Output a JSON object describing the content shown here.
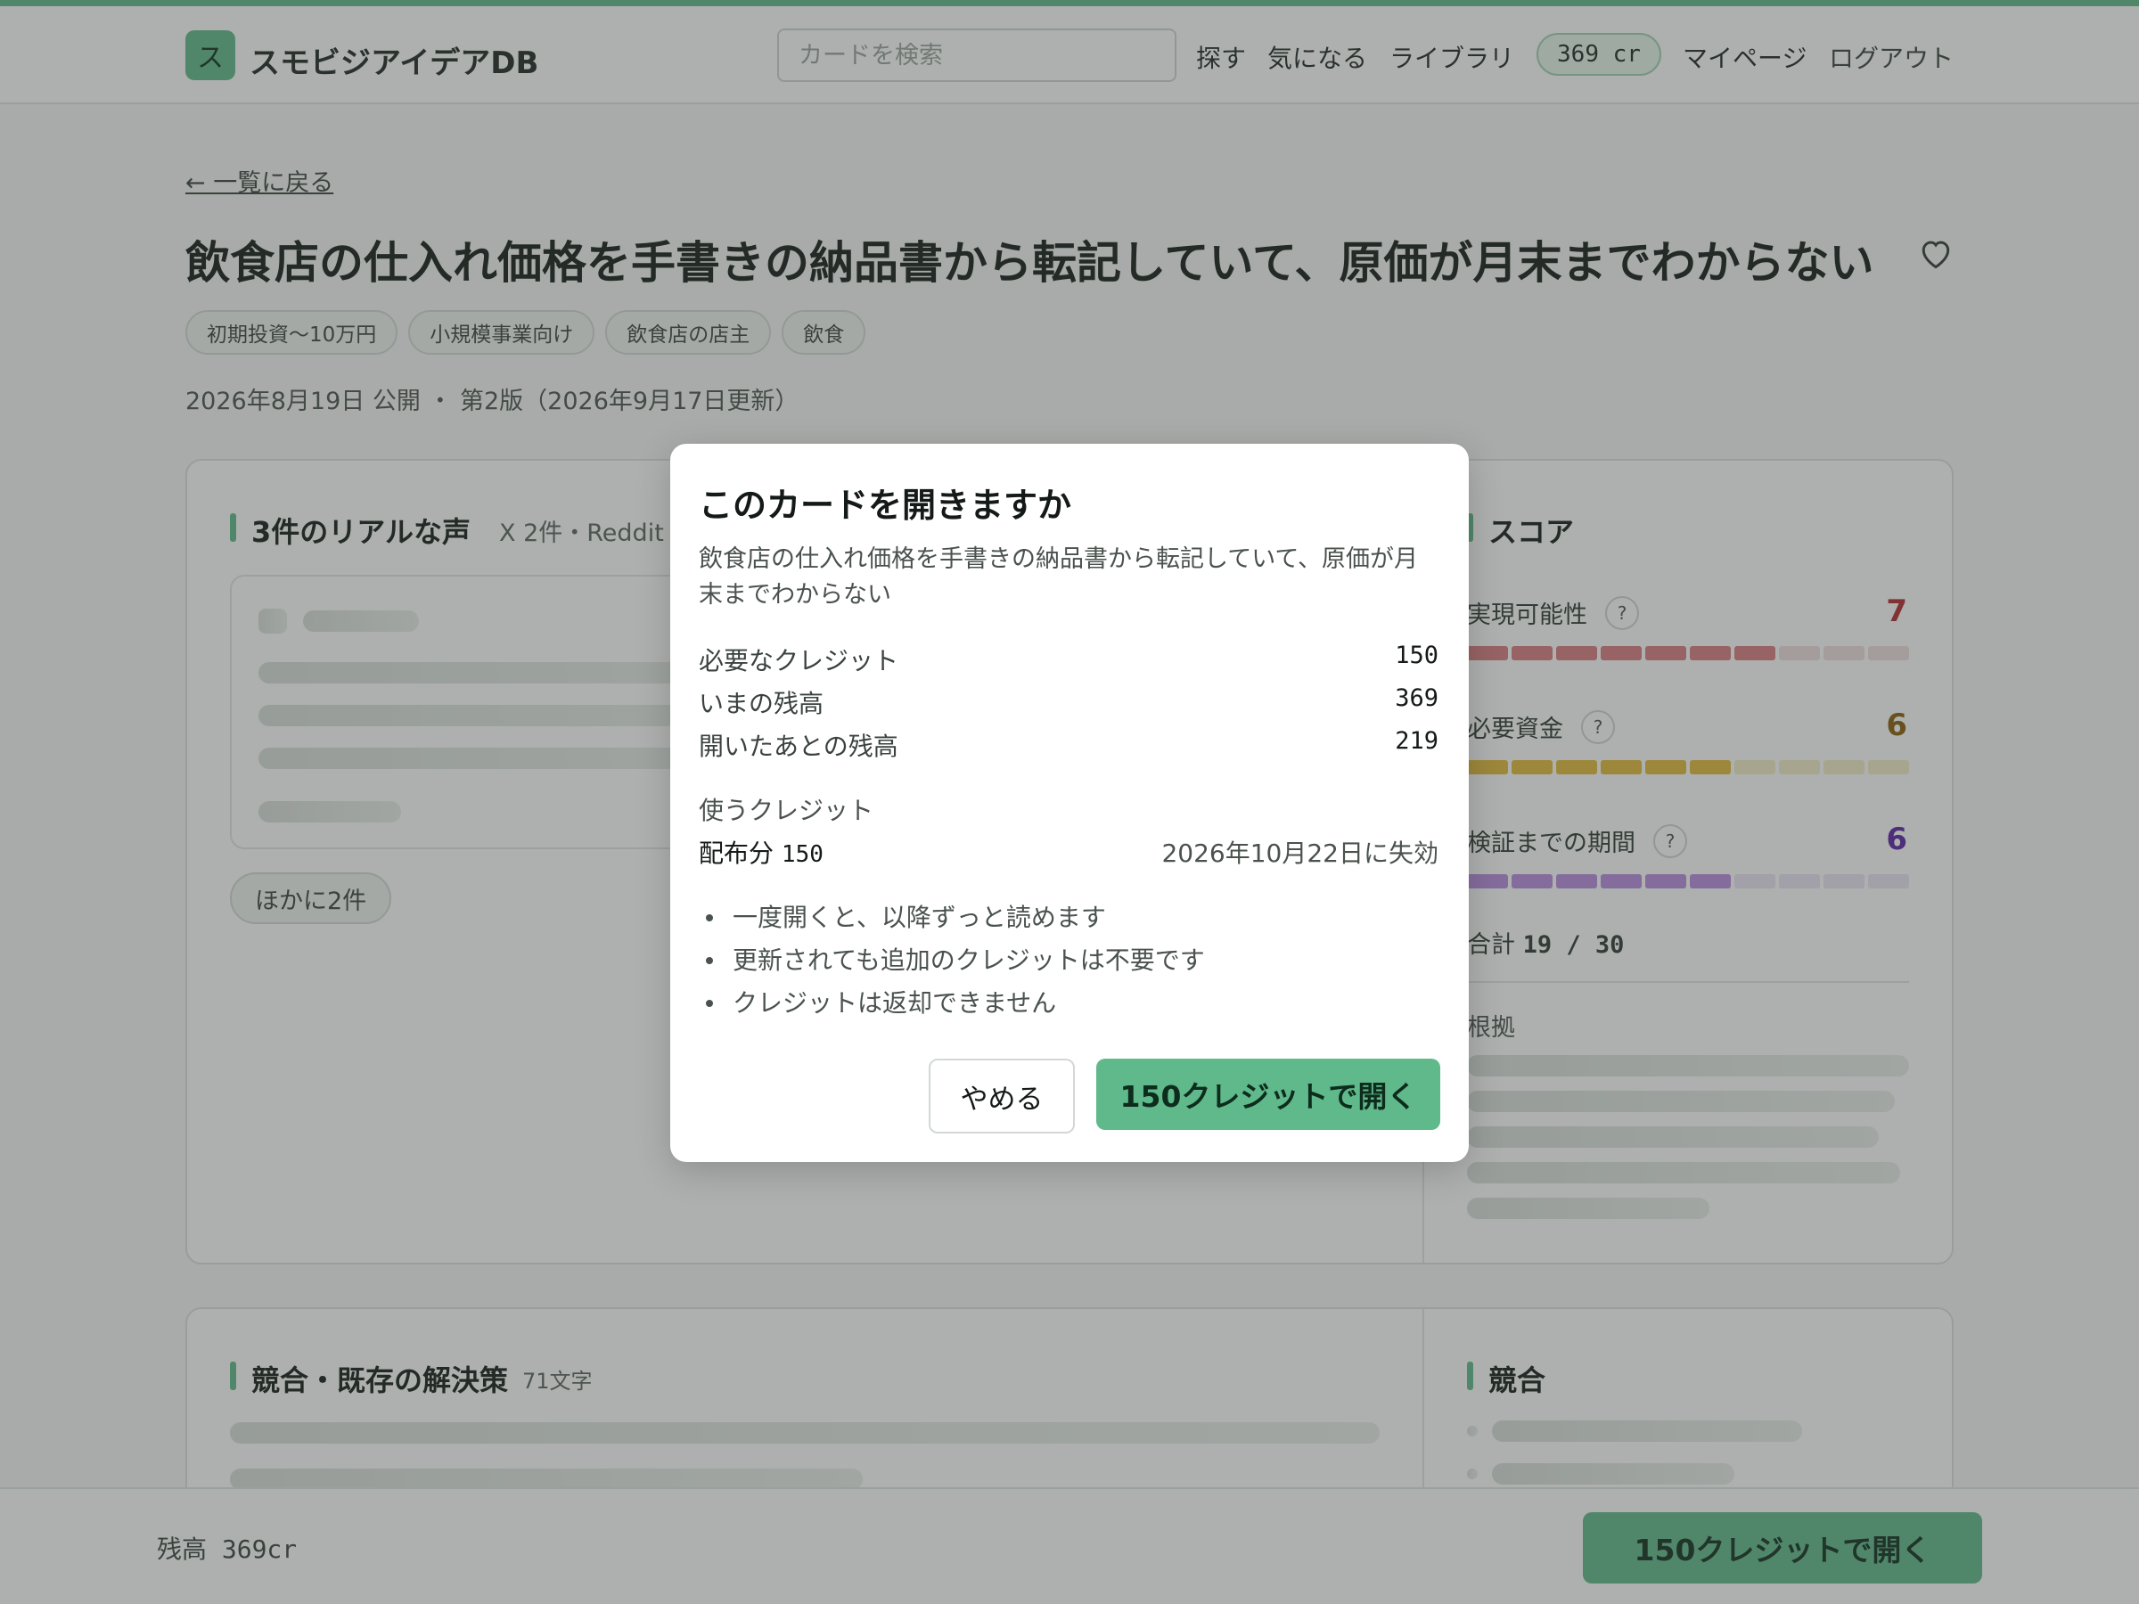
{
  "header": {
    "logo_char": "ス",
    "site_name": "スモビジアイデアDB",
    "search_placeholder": "カードを検索",
    "nav": [
      "探す",
      "気になる",
      "ライブラリ"
    ],
    "credits": "369 cr",
    "mypage": "マイページ",
    "logout": "ログアウト",
    "accent_color": "#5fb98a"
  },
  "page": {
    "back_link": "← 一覧に戻る",
    "title": "飲食店の仕入れ価格を手書きの納品書から転記していて、原価が月末までわからない",
    "favorite_icon": "heart-icon",
    "tags": [
      "初期投資〜10万円",
      "小規模事業向け",
      "飲食店の店主",
      "飲食"
    ],
    "meta": "2026年8月19日 公開 ・ 第2版（2026年9月17日更新）"
  },
  "voices": {
    "title": "3件のリアルな声",
    "sub": "X 2件・Reddit",
    "more_button": "ほかに2件"
  },
  "score": {
    "title": "スコア",
    "items": [
      {
        "label": "実現可能性",
        "value": "7",
        "level": 7,
        "max": 10,
        "color": "#b3262e",
        "bar_on": "#d97a80",
        "bar_off": "#f2dfe0"
      },
      {
        "label": "必要資金",
        "value": "6",
        "level": 6,
        "max": 10,
        "color": "#8a5a0a",
        "bar_on": "#e3b93a",
        "bar_off": "#f5ecc9"
      },
      {
        "label": "検証までの期間",
        "value": "6",
        "level": 6,
        "max": 10,
        "color": "#5a1fa6",
        "bar_on": "#b98ae0",
        "bar_off": "#ece3f5"
      }
    ],
    "help_icon": "?",
    "total_label": "合計",
    "total_value": "19 / 30",
    "basis_label": "根拠"
  },
  "competition": {
    "title": "競合・既存の解決策",
    "sub": "71文字",
    "side_title": "競合"
  },
  "bottombar": {
    "balance": "残高 369cr",
    "open_button": "150クレジットで開く"
  },
  "modal": {
    "title": "このカードを開きますか",
    "description": "飲食店の仕入れ価格を手書きの納品書から転記していて、原価が月末までわからない",
    "rows": [
      {
        "label": "必要なクレジット",
        "value": "150"
      },
      {
        "label": "いまの残高",
        "value": "369"
      },
      {
        "label": "開いたあとの残高",
        "value": "219"
      }
    ],
    "use_label": "使うクレジット",
    "use_source": "配布分",
    "use_amount": "150",
    "use_expiry": "2026年10月22日に失効",
    "bullets": [
      "一度開くと、以降ずっと読めます",
      "更新されても追加のクレジットは不要です",
      "クレジットは返却できません"
    ],
    "cancel_button": "やめる",
    "open_button": "150クレジットで開く"
  }
}
